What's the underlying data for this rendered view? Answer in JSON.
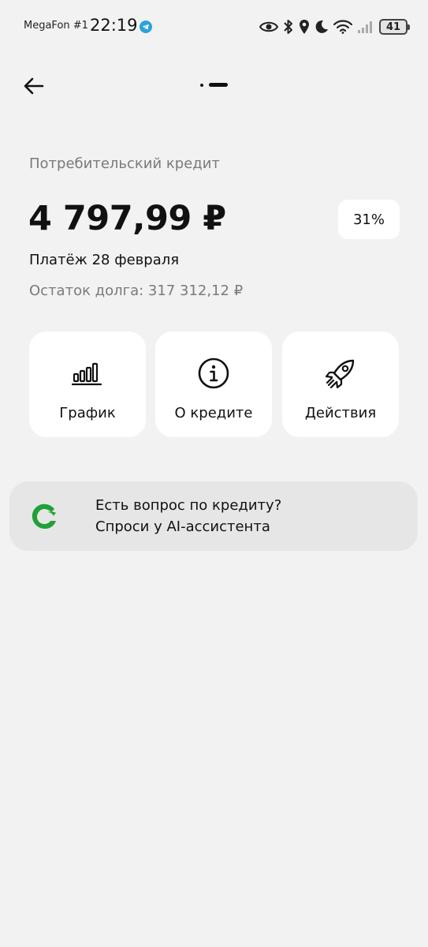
{
  "status_bar": {
    "carrier": "MegaFon #1",
    "time": "22:19",
    "battery": "41",
    "icons": [
      "telegram-icon",
      "eye-icon",
      "bluetooth-icon",
      "location-icon",
      "moon-icon",
      "wifi-icon",
      "signal-icon",
      "battery-icon"
    ]
  },
  "nav": {
    "back_icon": "arrow-left-icon",
    "pager": "dot-dash-indicator"
  },
  "loan": {
    "type": "Потребительский кредит",
    "amount": "4 797,99 ₽",
    "rate": "31%",
    "payment_date": "Платёж 28 февраля",
    "debt_remaining": "Остаток долга: 317 312,12 ₽"
  },
  "actions": [
    {
      "label": "График",
      "icon": "bar-chart-icon"
    },
    {
      "label": "О кредите",
      "icon": "info-icon"
    },
    {
      "label": "Действия",
      "icon": "rocket-icon"
    }
  ],
  "assistant": {
    "line1": "Есть вопрос по кредиту?",
    "line2": "Спроси у AI-ассистента",
    "logo_icon": "assistant-logo-icon",
    "logo_color": "#21a038"
  },
  "colors": {
    "background": "#f2f2f2",
    "card": "#ffffff",
    "banner": "#e6e6e6",
    "muted_text": "#7a7a7a"
  }
}
